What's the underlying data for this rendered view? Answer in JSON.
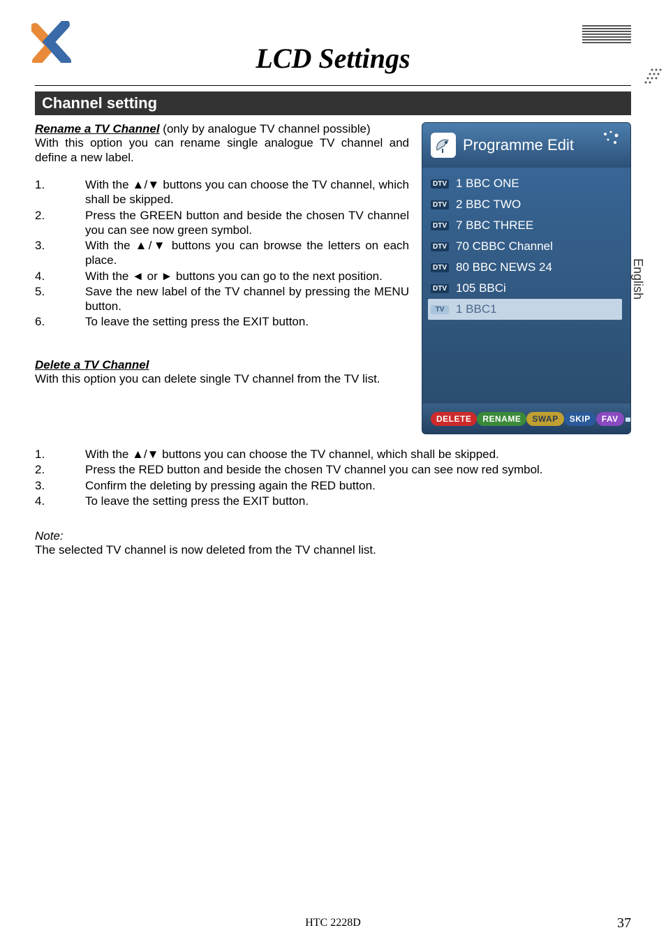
{
  "page_title": "LCD Settings",
  "section_header": "Channel setting",
  "rename_heading": "Rename a TV Channel",
  "rename_intro_suffix": "(only by analogue TV channel possible)",
  "rename_intro": "With this option you can rename single analogue TV channel and define a new label.",
  "rename_steps": [
    "With the ▲/▼ buttons you can choose the TV channel, which shall be skipped.",
    "Press the GREEN button and beside the chosen TV channel you can see now green symbol.",
    "With the ▲/▼ buttons you can browse the letters on each place.",
    "With the ◄ or ► buttons you can go to the next position.",
    "Save the new label of the TV channel by pressing the MENU button.",
    "To leave the setting press the EXIT button."
  ],
  "delete_heading": "Delete a TV Channel",
  "delete_intro": "With this option you can delete single TV channel from the TV list.",
  "delete_steps": [
    "With the ▲/▼ buttons you can choose the TV channel, which shall be skipped.",
    "Press the RED button and beside the chosen TV channel you can see now red symbol.",
    "Confirm the deleting by pressing again the RED button.",
    "To leave the setting press the EXIT button."
  ],
  "note_label": "Note:",
  "note_text": "The selected TV channel is now deleted from the TV channel list.",
  "osd": {
    "title": "Programme Edit",
    "items": [
      {
        "badge": "DTV",
        "label": "1 BBC ONE",
        "selected": false,
        "tv": false
      },
      {
        "badge": "DTV",
        "label": "2 BBC TWO",
        "selected": false,
        "tv": false
      },
      {
        "badge": "DTV",
        "label": "7 BBC THREE",
        "selected": false,
        "tv": false
      },
      {
        "badge": "DTV",
        "label": "70 CBBC Channel",
        "selected": false,
        "tv": false
      },
      {
        "badge": "DTV",
        "label": "80 BBC NEWS 24",
        "selected": false,
        "tv": false
      },
      {
        "badge": "DTV",
        "label": "105 BBCi",
        "selected": false,
        "tv": false
      },
      {
        "badge": "TV",
        "label": "1 BBC1",
        "selected": true,
        "tv": true
      }
    ],
    "footer": {
      "delete": "DELETE",
      "rename": "RENAME",
      "swap": "SWAP",
      "skip": "SKIP",
      "fav": "FAV"
    }
  },
  "side_tab": "English",
  "footer_model": "HTC 2228D",
  "footer_page": "37"
}
